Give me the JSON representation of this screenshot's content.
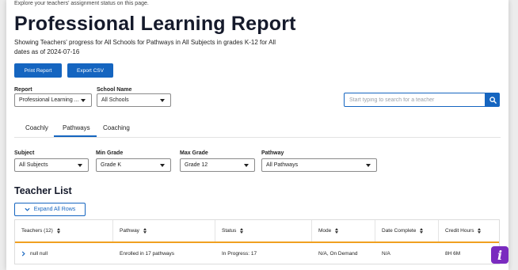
{
  "intro_text": "Explore your teachers' assignment status on this page.",
  "page_title": "Professional Learning Report",
  "subtitle": "Showing Teachers' progress for All Schools for Pathways in All Subjects in grades K-12 for All dates as of 2024-07-16",
  "actions": {
    "print_label": "Print Report",
    "export_label": "Export CSV"
  },
  "filters_top": {
    "report_label": "Report",
    "report_value": "Professional Learning ...",
    "school_label": "School Name",
    "school_value": "All Schools"
  },
  "search": {
    "placeholder": "Start typing to search for a teacher",
    "icon": "search-icon"
  },
  "tabs": [
    {
      "label": "Coachly",
      "active": false
    },
    {
      "label": "Pathways",
      "active": true
    },
    {
      "label": "Coaching",
      "active": false
    }
  ],
  "filters": {
    "subject_label": "Subject",
    "subject_value": "All Subjects",
    "min_grade_label": "Min Grade",
    "min_grade_value": "Grade K",
    "max_grade_label": "Max Grade",
    "max_grade_value": "Grade 12",
    "pathway_label": "Pathway",
    "pathway_value": "All Pathways"
  },
  "teacher_list": {
    "title": "Teacher List",
    "expand_label": "Expand All Rows",
    "columns": [
      "Teachers (12)",
      "Pathway",
      "Status",
      "Mode",
      "Date Complete",
      "Credit Hours"
    ],
    "rows": [
      {
        "teacher": "null null",
        "pathway": "Enrolled in 17 pathways",
        "status": "In Progress: 17",
        "mode": "N/A, On Demand",
        "date_complete": "N/A",
        "credit_hours": "8H 6M"
      }
    ]
  },
  "colors": {
    "accent": "#1565c0",
    "table_header_border": "#f0a020",
    "info_button": "#7a2bbf"
  }
}
